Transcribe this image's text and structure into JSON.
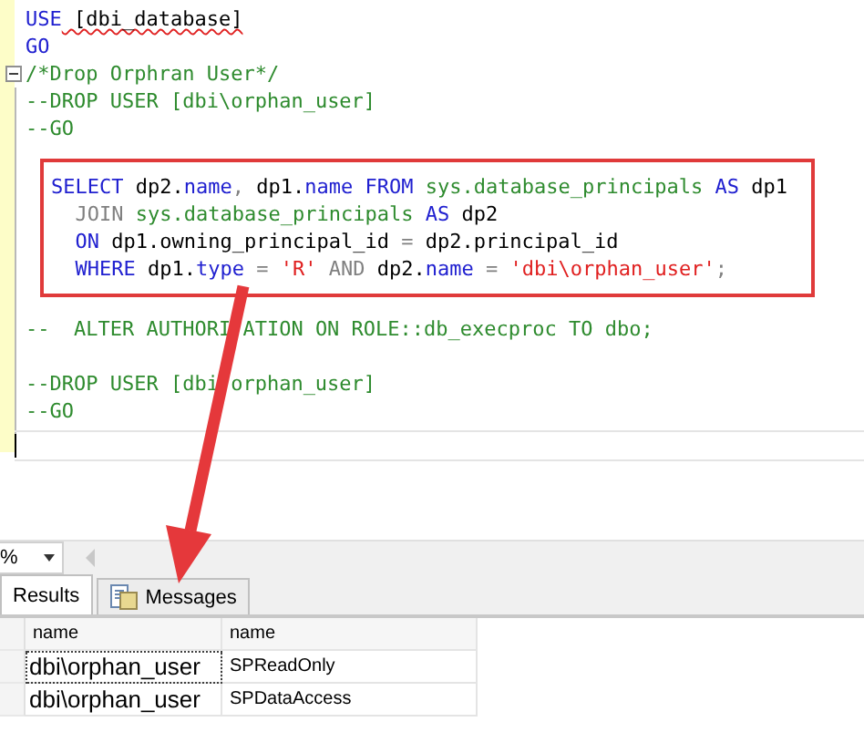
{
  "editor": {
    "lines": [
      {
        "tokens": [
          {
            "kind": "keyword",
            "text": "USE"
          },
          {
            "kind": "error",
            "text": " [dbi_database]"
          }
        ]
      },
      {
        "tokens": [
          {
            "kind": "keyword",
            "text": "GO"
          }
        ]
      },
      {
        "expanded": true,
        "tokens": [
          {
            "kind": "comment",
            "text": "/*Drop Orphran User*/"
          }
        ]
      },
      {
        "tokens": [
          {
            "kind": "comment",
            "text": "--DROP USER [dbi\\orphan_user]"
          }
        ]
      },
      {
        "tokens": [
          {
            "kind": "comment",
            "text": "--GO"
          }
        ]
      }
    ],
    "highlighted_lines": [
      {
        "tokens": [
          {
            "kind": "keyword",
            "text": "SELECT"
          },
          {
            "kind": "plain",
            "text": " dp2."
          },
          {
            "kind": "keyword",
            "text": "name"
          },
          {
            "kind": "operator",
            "text": ","
          },
          {
            "kind": "plain",
            "text": " dp1."
          },
          {
            "kind": "keyword",
            "text": "name FROM"
          },
          {
            "kind": "system",
            "text": " sys.database_principals"
          },
          {
            "kind": "keyword",
            "text": " AS"
          },
          {
            "kind": "plain",
            "text": " dp1"
          }
        ]
      },
      {
        "tokens": [
          {
            "kind": "operator",
            "text": "  JOIN"
          },
          {
            "kind": "system",
            "text": " sys.database_principals"
          },
          {
            "kind": "keyword",
            "text": " AS"
          },
          {
            "kind": "plain",
            "text": " dp2"
          }
        ]
      },
      {
        "tokens": [
          {
            "kind": "keyword",
            "text": "  ON"
          },
          {
            "kind": "plain",
            "text": " dp1.owning_principal_id"
          },
          {
            "kind": "operator",
            "text": " ="
          },
          {
            "kind": "plain",
            "text": " dp2.principal_id"
          }
        ]
      },
      {
        "tokens": [
          {
            "kind": "keyword",
            "text": "  WHERE"
          },
          {
            "kind": "plain",
            "text": " dp1."
          },
          {
            "kind": "keyword",
            "text": "type"
          },
          {
            "kind": "operator",
            "text": " ="
          },
          {
            "kind": "string",
            "text": " 'R'"
          },
          {
            "kind": "operator",
            "text": " AND"
          },
          {
            "kind": "plain",
            "text": " dp2."
          },
          {
            "kind": "keyword",
            "text": "name"
          },
          {
            "kind": "operator",
            "text": " ="
          },
          {
            "kind": "string",
            "text": " 'dbi\\orphan_user'"
          },
          {
            "kind": "operator",
            "text": ";"
          }
        ]
      }
    ],
    "after_lines": [
      {
        "tokens": [
          {
            "kind": "comment",
            "text": "--  ALTER AUTHORI"
          },
          {
            "kind": "comment",
            "gap_before": true,
            "text": "ATION ON ROLE::db_execproc TO dbo;"
          }
        ]
      },
      {
        "kind": "blank"
      },
      {
        "tokens": [
          {
            "kind": "comment",
            "text": "--DROP USER [dbi"
          },
          {
            "kind": "comment",
            "gap_before": true,
            "text": "orphan_user]"
          }
        ]
      },
      {
        "tokens": [
          {
            "kind": "comment",
            "text": "--GO"
          }
        ]
      }
    ]
  },
  "zoom": {
    "value": "%"
  },
  "tabs": [
    {
      "label": "Results",
      "selected": true
    },
    {
      "label": "Messages",
      "selected": false
    }
  ],
  "grid": {
    "columns": [
      "name",
      "name"
    ],
    "rows": [
      {
        "cells": [
          {
            "text": "dbi\\orphan_user",
            "selected": true
          },
          {
            "text": "SPReadOnly",
            "selected": false
          }
        ]
      },
      {
        "cells": [
          {
            "text": "dbi\\orphan_user",
            "selected": false
          },
          {
            "text": "SPDataAccess",
            "selected": false
          }
        ]
      }
    ]
  }
}
